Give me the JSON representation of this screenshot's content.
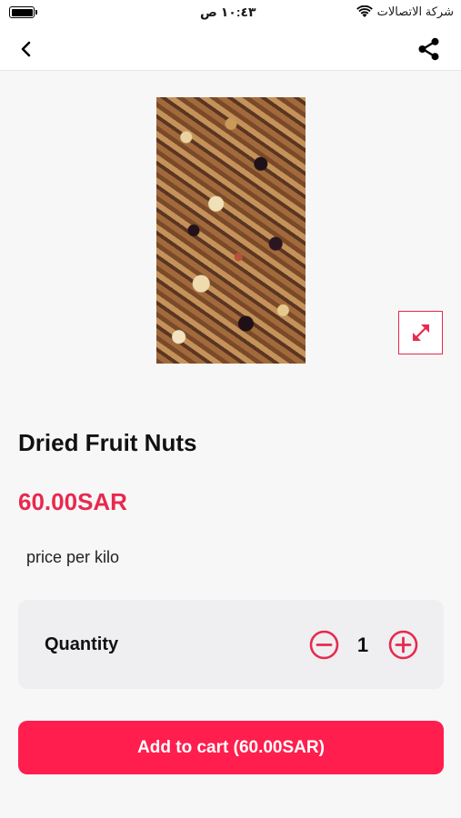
{
  "status_bar": {
    "time": "١٠:٤٣ ص",
    "carrier": "شركة الاتصالات",
    "battery_level": 1.0
  },
  "nav": {
    "back_icon": "chevron-left-icon",
    "share_icon": "share-icon"
  },
  "product": {
    "title": "Dried Fruit Nuts",
    "price": "60.00SAR",
    "unit_note": "price per kilo",
    "image_alt": "mixed dried fruits and nuts",
    "expand_icon": "expand-icon"
  },
  "quantity": {
    "label": "Quantity",
    "value": "1",
    "minus_icon": "minus-circle-icon",
    "plus_icon": "plus-circle-icon"
  },
  "cart_button": {
    "label": "Add to cart (60.00SAR)"
  },
  "colors": {
    "accent": "#e8294f",
    "button": "#ff1e4d",
    "card": "#efeff1",
    "background": "#f7f7f7"
  }
}
